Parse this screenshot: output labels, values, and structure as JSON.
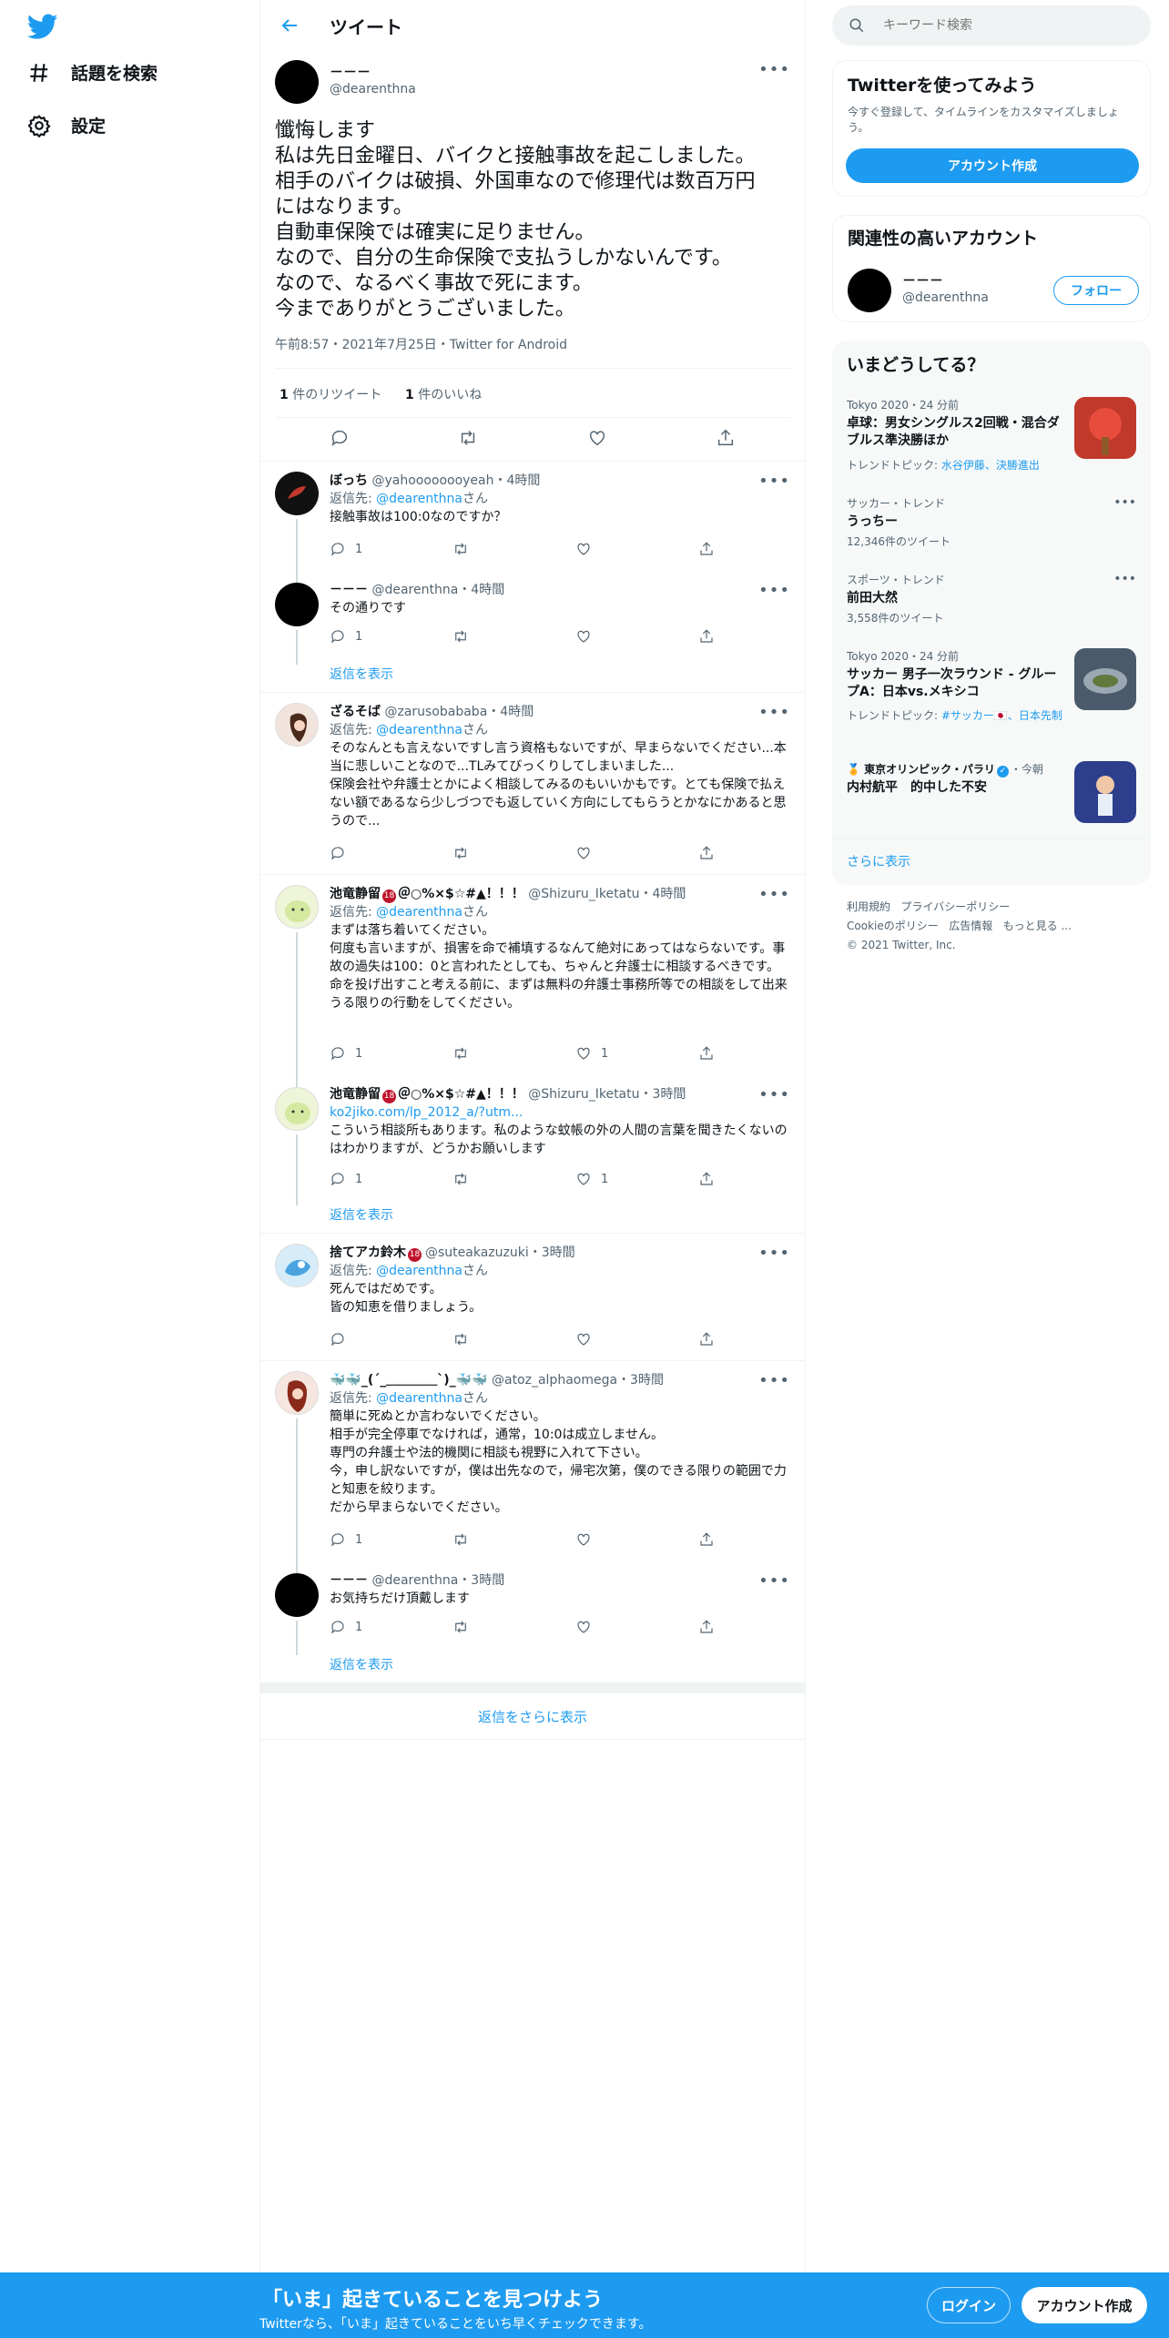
{
  "nav": {
    "explore_label": "話題を検索",
    "settings_label": "設定"
  },
  "header": {
    "title": "ツイート"
  },
  "tweet": {
    "name": "－－－",
    "handle": "@dearenthna",
    "lines": [
      "懺悔します",
      "私は先日金曜日、バイクと接触事故を起こしました。",
      "相手のバイクは破損、外国車なので修理代は数百万円",
      "にはなります。",
      "自動車保険では確実に足りません。",
      "なので、自分の生命保険で支払うしかないんです。",
      "なので、なるべく事故で死にます。",
      "今までありがとうございました。"
    ],
    "meta": "午前8:57・2021年7月25日・Twitter for Android",
    "retweet_count": "1",
    "retweet_label": " 件のリツイート",
    "like_count": "1",
    "like_label": " 件のいいね"
  },
  "replies": [
    {
      "name": "ぼっち",
      "handle": "@yahoooooooyeah",
      "time": "・4時間",
      "reply_to_prefix": "返信先: ",
      "reply_to": "@dearenthna",
      "reply_to_suffix": "さん",
      "text": "接触事故は100:0なのですか？",
      "reply_count": "1",
      "like_count": ""
    },
    {
      "name": "－－－",
      "handle": "@dearenthna",
      "time": "・4時間",
      "text": "その通りです",
      "reply_count": "1",
      "like_count": "",
      "show_replies": "返信を表示"
    },
    {
      "name": "ざるそば",
      "handle": "@zarusobababa",
      "time": "・4時間",
      "reply_to_prefix": "返信先: ",
      "reply_to": "@dearenthna",
      "reply_to_suffix": "さん",
      "text": "そのなんとも言えないですし言う資格もないですが、早まらないでください...本当に悲しいことなので...TLみてびっくりしてしまいました...\n保険会社や弁護士とかによく相談してみるのもいいかもです。とても保険で払えない額であるなら少しづつでも返していく方向にしてもらうとかなにかあると思うので...",
      "reply_count": "",
      "like_count": ""
    },
    {
      "name": "池竜静留",
      "badge": "18",
      "name_suffix": "＠○%×$☆#▲！！！",
      "handle": "@Shizuru_Iketatu",
      "time": "・4時間",
      "reply_to_prefix": "返信先: ",
      "reply_to": "@dearenthna",
      "reply_to_suffix": "さん",
      "text": "まずは落ち着いてください。\n何度も言いますが、損害を命で補填するなんて絶対にあってはならないです。事故の過失は100：0と言われたとしても、ちゃんと弁護士に相談するべきです。\n命を投げ出すこと考える前に、まずは無料の弁護士事務所等での相談をして出来うる限りの行動をしてください。",
      "reply_count": "1",
      "like_count": "1"
    },
    {
      "name": "池竜静留",
      "badge": "18",
      "name_suffix": "＠○%×$☆#▲！！！",
      "handle": "@Shizuru_Iketatu",
      "time": "・3時間",
      "link": "ko2jiko.com/lp_2012_a/?utm...",
      "text": "こういう相談所もあります。私のような蚊帳の外の人間の言葉を聞きたくないのはわかりますが、どうかお願いします",
      "reply_count": "1",
      "like_count": "1",
      "show_replies": "返信を表示"
    },
    {
      "name": "捨てアカ鈴木",
      "badge": "18",
      "handle": "@suteakazuzuki",
      "time": "・3時間",
      "reply_to_prefix": "返信先: ",
      "reply_to": "@dearenthna",
      "reply_to_suffix": "さん",
      "text": "死んではだめです。\n皆の知恵を借りましょう。",
      "reply_count": "",
      "like_count": ""
    },
    {
      "name": "🐳🐳_(´_＿＿＿＿`)_🐳🐳",
      "handle": "@atoz_alphaomega",
      "time": "・3時間",
      "reply_to_prefix": "返信先: ",
      "reply_to": "@dearenthna",
      "reply_to_suffix": "さん",
      "text": "簡単に死ぬとか言わないでください。\n相手が完全停車でなければ，通常，10:0は成立しません。\n専門の弁護士や法的機関に相談も視野に入れて下さい。\n今，申し訳ないですが，僕は出先なので，帰宅次第，僕のできる限りの範囲で力と知恵を絞ります。\nだから早まらないでください。",
      "reply_count": "1",
      "like_count": ""
    },
    {
      "name": "－－－",
      "handle": "@dearenthna",
      "time": "・3時間",
      "text": "お気持ちだけ頂戴します",
      "reply_count": "1",
      "like_count": "",
      "show_replies": "返信を表示"
    }
  ],
  "show_more_replies": "返信をさらに表示",
  "sidebar": {
    "search_placeholder": "キーワード検索",
    "signup": {
      "title": "Twitterを使ってみよう",
      "desc": "今すぐ登録して、タイムラインをカスタマイズしましょう。",
      "button": "アカウント作成"
    },
    "related": {
      "title": "関連性の高いアカウント",
      "name": "－－－",
      "handle": "@dearenthna",
      "follow": "フォロー"
    },
    "trends": {
      "title": "いまどうしてる？",
      "items": [
        {
          "meta": "Tokyo 2020・24 分前",
          "title": "卓球：男女シングルス2回戦・混合ダブルス準決勝ほか",
          "sub_prefix": "トレンドトピック: ",
          "sub_link": "水谷伊藤、決勝進出"
        },
        {
          "meta": "サッカー・トレンド",
          "title": "うっちー",
          "sub": "12,346件のツイート"
        },
        {
          "meta": "スポーツ・トレンド",
          "title": "前田大然",
          "sub": "3,558件のツイート"
        },
        {
          "meta": "Tokyo 2020・24 分前",
          "title": "サッカー 男子一次ラウンド - グループA：日本vs.メキシコ",
          "sub_prefix": "トレンドトピック: ",
          "sub_link": "#サッカー🇯🇵、日本先制"
        },
        {
          "meta_prefix": "🏅 東京オリンピック・パラリ",
          "meta_suffix": "・今朝",
          "title": "内村航平　的中した不安"
        }
      ],
      "more": "さらに表示"
    },
    "footer": {
      "links": [
        "利用規約",
        "プライバシーポリシー",
        "Cookieのポリシー",
        "広告情報",
        "もっと見る ..."
      ],
      "copyright": "© 2021 Twitter, Inc."
    }
  },
  "bottom_bar": {
    "title": "「いま」起きていることを見つけよう",
    "subtitle": "Twitterなら、「いま」起きていることをいち早くチェックできます。",
    "login": "ログイン",
    "signup": "アカウント作成"
  },
  "colors": {
    "accent": "#1d9bf0",
    "text": "#0f1419",
    "muted": "#536471"
  }
}
